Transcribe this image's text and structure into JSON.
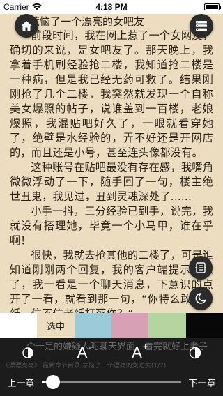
{
  "status_bar": {
    "carrier": "Carrier",
    "time": "4:18 PM"
  },
  "chapter_title": "惹恼了一个漂亮的女吧友",
  "paragraphs": [
    "前段时间，我在网上惹了一个女网友，确切的来说，是女吧友了。那天晚上，我拿着手机刷经验抢二楼，我知道抢二楼是一种病，但是我已经无药可救了。结果刚刚抢了几个二楼，我突然就发现一个自称美女爆照的帖子，说谁盖到一百楼，老娘爆照，我混贴吧好久了，一眼就看穿她了，绝壁是水经验的，弄不好还是开网店的，而且还是小号，甚至连头像都没有。",
    "这种账号在贴吧最没有存在感，我嘴角微微浮动了一下，随手回了一句，楼主绝世丑鬼，我见过，丑到灵魂深处了......",
    "小手一抖，三分经验已到手，说完，我就没有搭理她，毕竟一个小马甲，谁在乎啊！",
    "很快，我就去抢其他的二楼了，可是谁知道刚刚两个回复，我的客户端提示信息了，我一看是一个聊天消息，下意识的点开了一看，就看到那一句，“你特么敢骂老纸，信不信老纸打死你？”"
  ],
  "theme_swatches": [
    {
      "color": "#ffffff",
      "label": ""
    },
    {
      "color": "#ecdcc0",
      "label": "选中"
    },
    {
      "color": "#9ccad8",
      "label": ""
    },
    {
      "color": "#d8a0b4",
      "label": ""
    },
    {
      "color": "#b4d4a0",
      "label": ""
    },
    {
      "color": "#080808",
      "label": ""
    }
  ],
  "controls": {
    "font_smaller": "A",
    "font_smaller_sign": "-",
    "font_larger": "A",
    "font_larger_sign": "+",
    "behind_text": "个十足的嫌疑人呢聊天界面，看完就好上老子",
    "behind_text2": "《漂漂亮亮》 最新章节目录 惹恼了一个漂亮的女吧友(1/7)"
  },
  "progress": {
    "prev_label": "上一章",
    "next_label": "下一章",
    "value": 0.03
  },
  "icons": {
    "home": "home-icon",
    "list": "list-icon",
    "toc": "toc-icon",
    "night": "night-mode-icon",
    "brightness": "brightness-icon"
  }
}
